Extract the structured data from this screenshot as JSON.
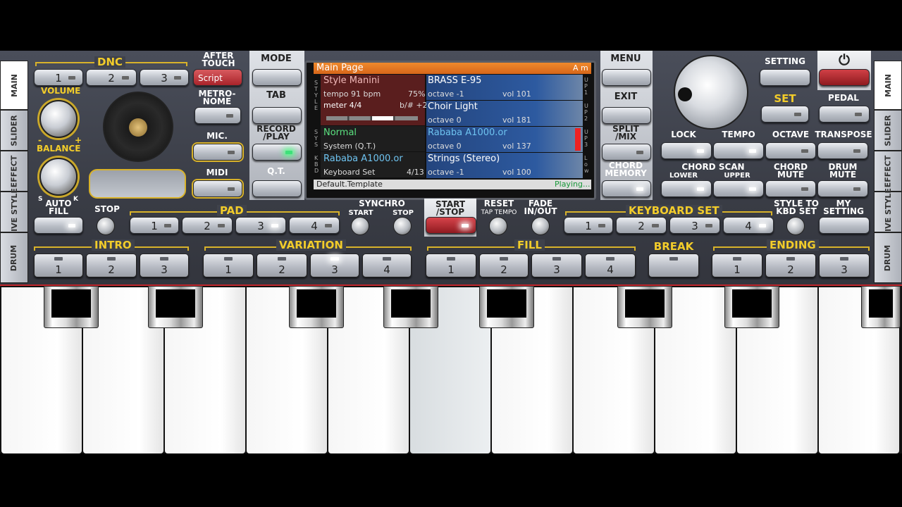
{
  "left_tabs": [
    "MAIN",
    "SLIDER",
    "EFFECT",
    "LIVE STYLE",
    "DRUM"
  ],
  "right_tabs": [
    "MAIN",
    "SLIDER",
    "EFFECT",
    "LIVE STYLE",
    "DRUM"
  ],
  "dnc": {
    "label": "DNC",
    "buttons": [
      "1",
      "2",
      "3"
    ]
  },
  "after_touch": {
    "label": "AFTER TOUCH",
    "value": "Script"
  },
  "volume_label": "VOLUME",
  "balance_label": "BALANCE",
  "balance_s": "S",
  "balance_k": "K",
  "minus": "-",
  "plus": "+",
  "metronome_label": "METRO- NOME",
  "mic_label": "MIC.",
  "midi_label": "MIDI",
  "mode_label": "MODE",
  "tab_label": "TAB",
  "record_label": "RECORD /PLAY",
  "qt_label": "Q.T.",
  "menu_label": "MENU",
  "exit_label": "EXIT",
  "split_label": "SPLIT /MIX",
  "chord_memory_label": "CHORD MEMORY",
  "lcd": {
    "header": "Main Page",
    "chord": "A m",
    "style_name": "Style Manini",
    "tempo": "tempo 91 bpm",
    "tempo_pct": "75%",
    "meter": "meter 4/4",
    "transpose": "b/# +2",
    "side_style": "STYLE",
    "side_sys": "SYS",
    "side_kbd": "KBD",
    "sys_name": "Normal",
    "sys_sub": "System (Q.T.)",
    "kbd_name": "Rababa A1000.or",
    "kbd_sub": "Keyboard Set",
    "kbd_count": "4/13",
    "footer_left": "Default.Template",
    "footer_right": "Playing...",
    "parts": [
      {
        "name": "BRASS E-95",
        "octave": "octave -1",
        "vol": "vol 101",
        "side": "UP1"
      },
      {
        "name": "Choir Light",
        "octave": "octave  0",
        "vol": "vol 181",
        "side": "UP2"
      },
      {
        "name": "Rababa A1000.or",
        "octave": "octave  0",
        "vol": "vol 137",
        "side": "UP3"
      },
      {
        "name": "Strings (Stereo)",
        "octave": "octave -1",
        "vol": "vol 100",
        "side": "Low"
      }
    ]
  },
  "setting_label": "SETTING",
  "set_label": "SET",
  "pedal_label": "PEDAL",
  "power_icon": "⏻",
  "lock_label": "LOCK",
  "tempo_label": "TEMPO",
  "octave_label": "OCTAVE",
  "transpose_label": "TRANSPOSE",
  "chord_scan_label": "CHORD SCAN",
  "lower_label": "LOWER",
  "upper_label": "UPPER",
  "chord_mute_label": "CHORD MUTE",
  "drum_mute_label": "DRUM MUTE",
  "auto_fill_label": "AUTO FILL",
  "stop_label": "STOP",
  "pad": {
    "label": "PAD",
    "buttons": [
      "1",
      "2",
      "3",
      "4"
    ]
  },
  "synchro_label": "SYNCHRO",
  "start_label": "START",
  "synchro_stop_label": "STOP",
  "start_stop_label": "START /STOP",
  "reset_label": "RESET",
  "tap_tempo_label": "TAP TEMPO",
  "fade_label": "FADE IN/OUT",
  "keyboard_set": {
    "label": "KEYBOARD SET",
    "buttons": [
      "1",
      "2",
      "3",
      "4"
    ]
  },
  "style_to_kbd_label": "STYLE TO KBD SET",
  "my_setting_label": "MY SETTING",
  "intro": {
    "label": "INTRO",
    "buttons": [
      "1",
      "2",
      "3"
    ]
  },
  "variation": {
    "label": "VARIATION",
    "buttons": [
      "1",
      "2",
      "3",
      "4"
    ]
  },
  "fill": {
    "label": "FILL",
    "buttons": [
      "1",
      "2",
      "3",
      "4"
    ]
  },
  "break_label": "BREAK",
  "ending": {
    "label": "ENDING",
    "buttons": [
      "1",
      "2",
      "3"
    ]
  },
  "colors": {
    "accent": "#f2cc2a",
    "lcd_header": "#e8771c",
    "start_stop": "#c0262c"
  }
}
